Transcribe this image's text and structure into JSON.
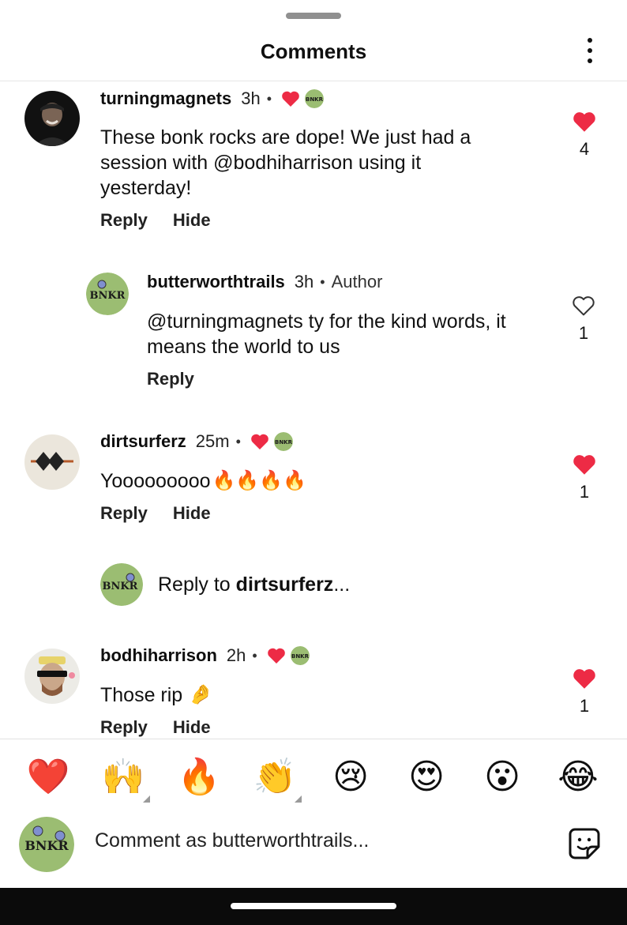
{
  "header": {
    "title": "Comments"
  },
  "comments": [
    {
      "username": "turningmagnets",
      "time": "3h",
      "text_lines": [
        "These bonk rocks are dope! We just had a",
        "session with @bodhiharrison using it",
        "yesterday!"
      ],
      "actions": {
        "reply": "Reply",
        "hide": "Hide"
      },
      "likes": "4",
      "liked": true
    },
    {
      "username": "butterworthtrails",
      "time": "3h",
      "tag": "Author",
      "text_lines": [
        "@turningmagnets ty for the kind words, it",
        "means the world to us"
      ],
      "actions": {
        "reply": "Reply"
      },
      "likes": "1",
      "liked": false
    },
    {
      "username": "dirtsurferz",
      "time": "25m",
      "text": "Yooooooooo",
      "actions": {
        "reply": "Reply",
        "hide": "Hide"
      },
      "likes": "1",
      "liked": true
    },
    {
      "username": "bodhiharrison",
      "time": "2h",
      "text": "Those rip",
      "actions": {
        "reply": "Reply",
        "hide": "Hide"
      },
      "likes": "1",
      "liked": true
    }
  ],
  "reply_prompt": {
    "prefix": "Reply to ",
    "username": "dirtsurferz",
    "suffix": "..."
  },
  "reactions": [
    "❤️",
    "🙌",
    "🔥",
    "👏",
    "😢",
    "😍",
    "😮",
    "😂"
  ],
  "composer": {
    "placeholder": "Comment as butterworthtrails..."
  },
  "avatar_text": {
    "brand": "BNKR"
  },
  "icons": [
    "heart-icon",
    "more-options-icon",
    "sticker-icon",
    "fire-icon",
    "pinch-hand-icon"
  ],
  "colors": {
    "like_red": "#ed2b45",
    "avatar_green": "#9bbd72",
    "nav_bar": "#0b0b0b"
  }
}
